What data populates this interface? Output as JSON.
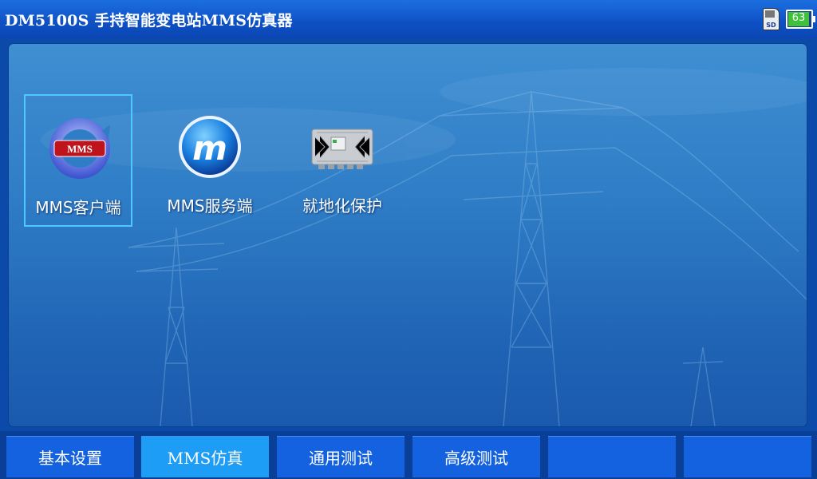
{
  "header": {
    "title": "DM5100S 手持智能变电站MMS仿真器",
    "sd_label": "SD",
    "battery": "63"
  },
  "apps": [
    {
      "label": "MMS客户端",
      "icon": "mms-client-icon",
      "selected": true
    },
    {
      "label": "MMS服务端",
      "icon": "mms-server-icon",
      "selected": false
    },
    {
      "label": "就地化保护",
      "icon": "device-icon",
      "selected": false
    }
  ],
  "tabs": [
    {
      "label": "基本设置"
    },
    {
      "label": "MMS仿真"
    },
    {
      "label": "通用测试"
    },
    {
      "label": "高级测试"
    },
    {
      "label": ""
    },
    {
      "label": ""
    }
  ],
  "colors": {
    "titlebar": "#0e50c4",
    "tab": "#1462e0",
    "tab_active": "#1d9df6",
    "selection": "#4fc8ff",
    "battery_fill": "#3fc23a"
  }
}
